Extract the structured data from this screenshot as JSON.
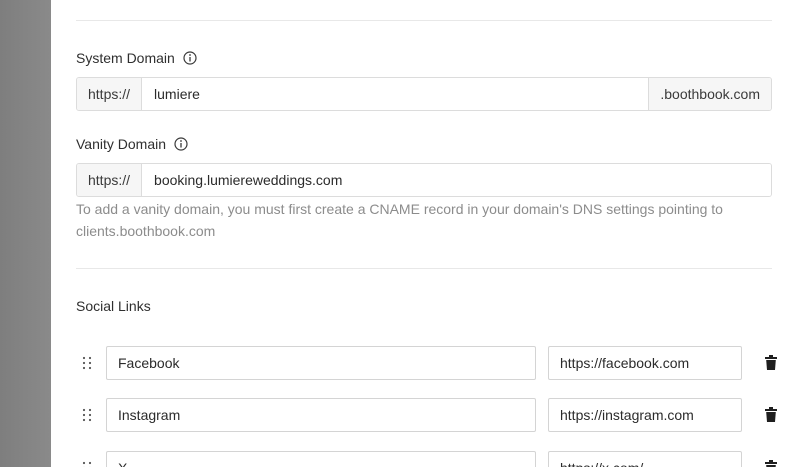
{
  "system_domain": {
    "label": "System Domain",
    "prefix": "https://",
    "value": "lumiere",
    "suffix": ".boothbook.com"
  },
  "vanity_domain": {
    "label": "Vanity Domain",
    "prefix": "https://",
    "value": "booking.lumiereweddings.com",
    "help": "To add a vanity domain, you must first create a CNAME record in your domain's DNS settings pointing to clients.boothbook.com"
  },
  "social_links": {
    "title": "Social Links",
    "items": [
      {
        "name": "Facebook",
        "url": "https://facebook.com"
      },
      {
        "name": "Instagram",
        "url": "https://instagram.com"
      },
      {
        "name": "X",
        "url": "https://x.com/"
      }
    ]
  },
  "icons": {
    "info": "info-icon",
    "drag": "drag-handle-icon",
    "delete": "trash-icon"
  }
}
